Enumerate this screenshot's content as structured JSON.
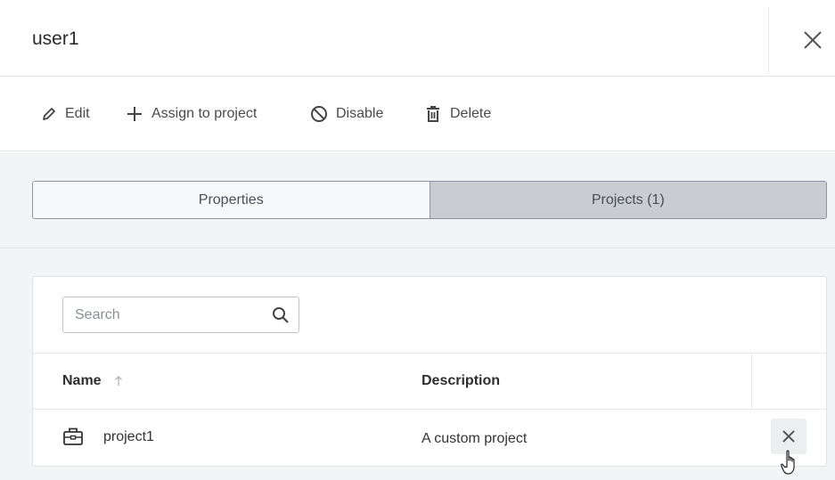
{
  "header": {
    "title": "user1"
  },
  "toolbar": {
    "edit_label": "Edit",
    "assign_label": "Assign to project",
    "disable_label": "Disable",
    "delete_label": "Delete"
  },
  "tabs": [
    {
      "label": "Properties",
      "selected": false
    },
    {
      "label": "Projects (1)",
      "selected": true
    }
  ],
  "search": {
    "placeholder": "Search",
    "value": ""
  },
  "table": {
    "columns": [
      "Name",
      "Description"
    ],
    "sort": {
      "column": "Name",
      "direction": "ascending"
    },
    "rows": [
      {
        "name": "project1",
        "description": "A custom project",
        "icon": "briefcase-icon"
      }
    ]
  },
  "colors": {
    "content_bg": "#f3f4f6",
    "tab_selected_bg": "#c9ccd0",
    "tab_unselected_bg": "#f7f8f9",
    "border": "#8d949b"
  }
}
